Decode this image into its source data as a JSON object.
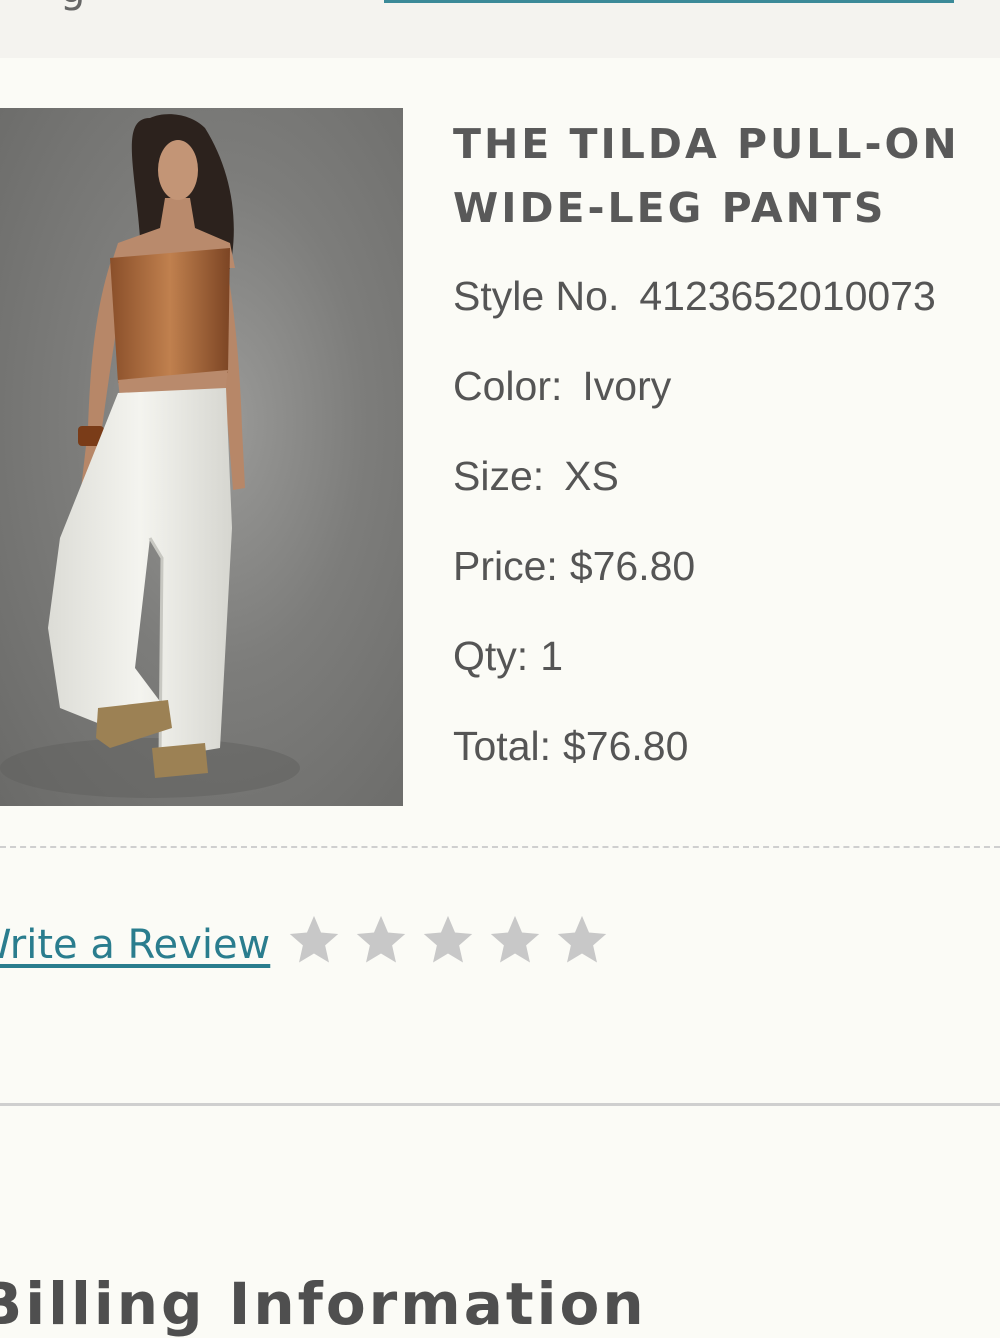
{
  "header": {
    "partial_text": "g"
  },
  "product": {
    "image_alt": "Model wearing ivory wide-leg pants with a copper strapless top",
    "title_line1": "THE TILDA PULL-ON",
    "title_line2": "WIDE-LEG PANTS",
    "style_label": "Style No.",
    "style_value": "4123652010073",
    "color_label": "Color:",
    "color_value": "Ivory",
    "size_label": "Size:",
    "size_value": "XS",
    "price_label": "Price:",
    "price_value": "$76.80",
    "qty_label": "Qty:",
    "qty_value": "1",
    "total_label": "Total:",
    "total_value": "$76.80"
  },
  "review": {
    "link_text": "Write a Review",
    "rating": 0,
    "max_rating": 5,
    "star_color": "#c8c8c8"
  },
  "section": {
    "heading": "Billing Information"
  },
  "colors": {
    "link": "#2a7d8e",
    "background": "#fbfbf6"
  }
}
